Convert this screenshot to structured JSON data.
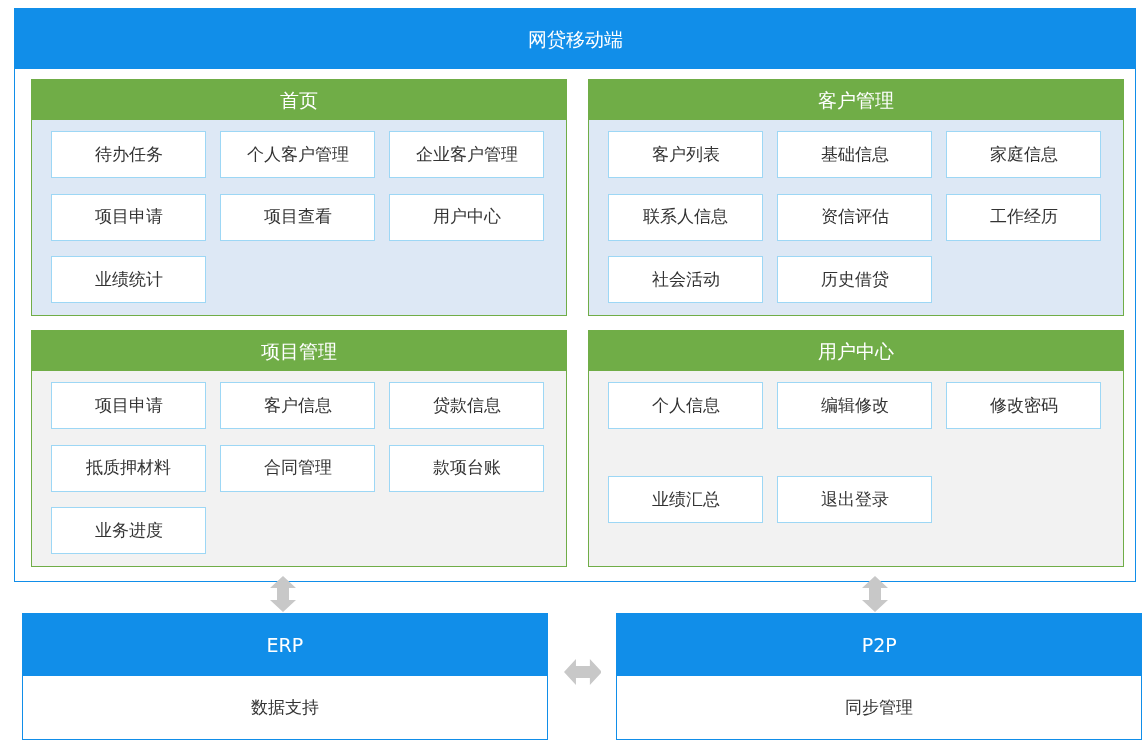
{
  "app": {
    "title": "网贷移动端"
  },
  "sections": [
    {
      "title": "首页",
      "color": "#dde8f5",
      "items": [
        "待办任务",
        "个人客户管理",
        "企业客户管理",
        "项目申请",
        "项目查看",
        "用户中心",
        "业绩统计"
      ]
    },
    {
      "title": "客户管理",
      "color": "#dde8f5",
      "items": [
        "客户列表",
        "基础信息",
        "家庭信息",
        "联系人信息",
        "资信评估",
        "工作经历",
        "社会活动",
        "历史借贷"
      ]
    },
    {
      "title": "项目管理",
      "color": "#f2f2f2",
      "items": [
        "项目申请",
        "客户信息",
        "贷款信息",
        "抵质押材料",
        "合同管理",
        "款项台账",
        "业务进度"
      ]
    },
    {
      "title": "用户中心",
      "color": "#f2f2f2",
      "items": [
        "个人信息",
        "编辑修改",
        "修改密码",
        "业绩汇总",
        "退出登录"
      ]
    }
  ],
  "systems": [
    {
      "title": "ERP",
      "body": "数据支持"
    },
    {
      "title": "P2P",
      "body": "同步管理"
    }
  ]
}
